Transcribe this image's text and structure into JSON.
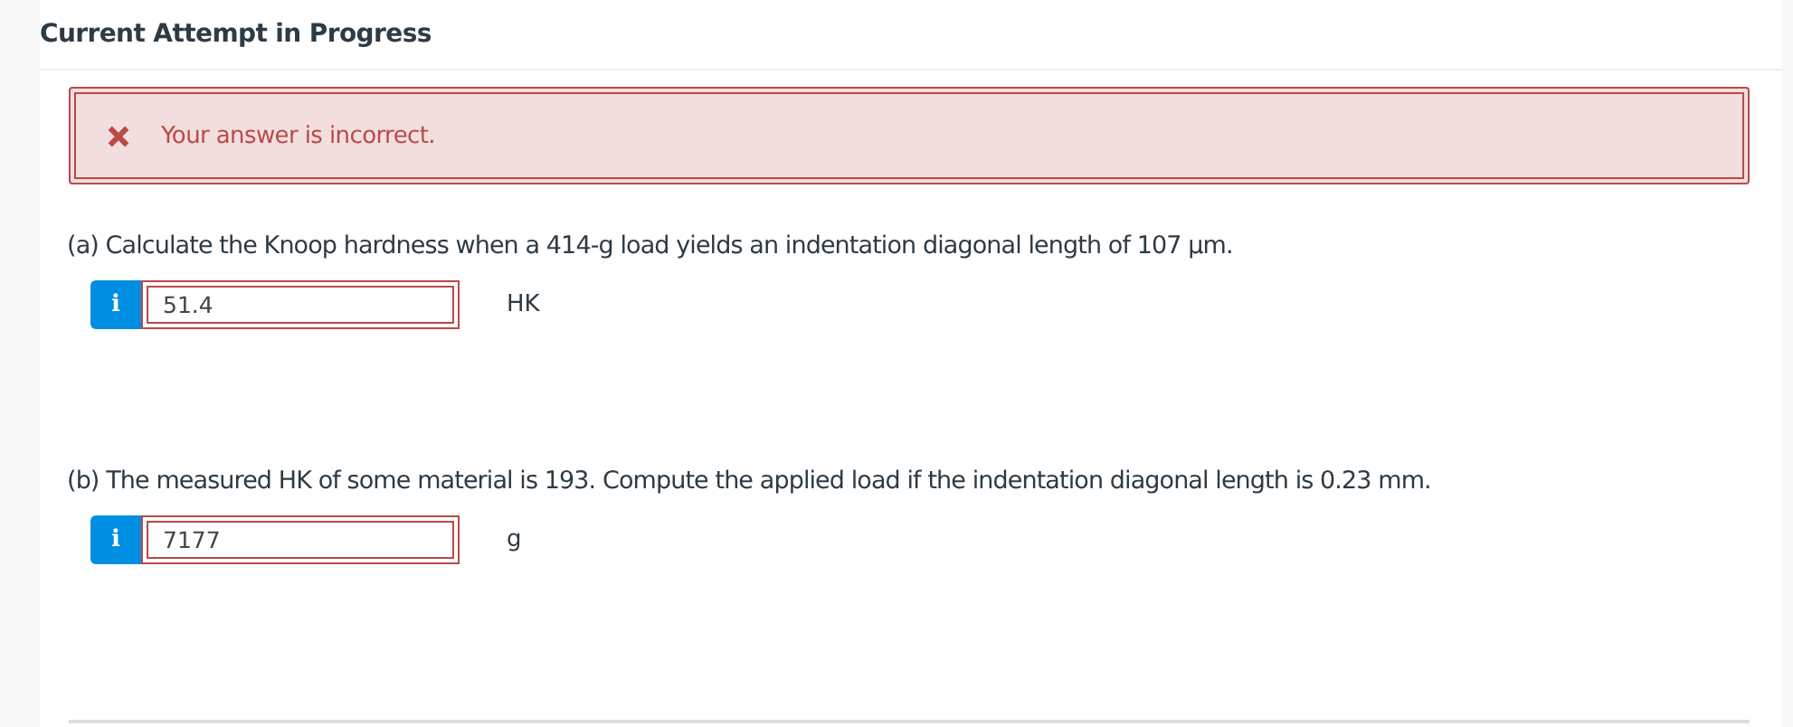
{
  "heading": "Current Attempt in Progress",
  "alert": {
    "kind": "error",
    "message": "Your answer is incorrect."
  },
  "questions": [
    {
      "prompt": "(a) Calculate the Knoop hardness when a 414-g load yields an indentation diagonal length of 107 μm.",
      "info": "i",
      "value": "51.4",
      "unit": "HK",
      "incorrect": true
    },
    {
      "prompt": "(b) The measured HK of some material is 193. Compute the applied load if the indentation diagonal length is 0.23 mm.",
      "info": "i",
      "value": "7177",
      "unit": "g",
      "incorrect": true
    }
  ]
}
